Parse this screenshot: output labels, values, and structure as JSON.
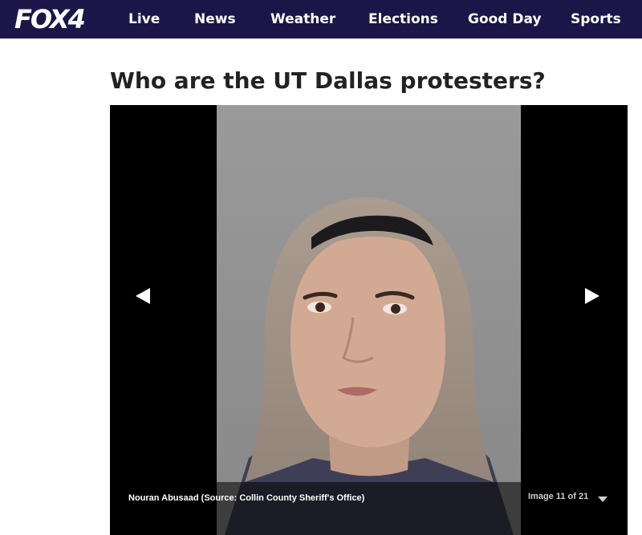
{
  "nav": {
    "logo": "FOX4",
    "items": [
      {
        "label": "Live"
      },
      {
        "label": "News"
      },
      {
        "label": "Weather"
      },
      {
        "label": "Elections"
      },
      {
        "label": "Good Day"
      },
      {
        "label": "Sports"
      }
    ]
  },
  "article": {
    "headline": "Who are the UT Dallas protesters?"
  },
  "gallery": {
    "caption": "Nouran Abusaad (Source: Collin County Sheriff's Office)",
    "counter": "Image 11 of 21",
    "prev_icon": "left-triangle-icon",
    "next_icon": "right-triangle-icon",
    "dropdown_icon": "chevron-down-icon"
  },
  "colors": {
    "nav_bg": "#1c1648",
    "headline": "#222222",
    "gallery_bg": "#000000",
    "photo_bg": "#8f8f8f"
  }
}
